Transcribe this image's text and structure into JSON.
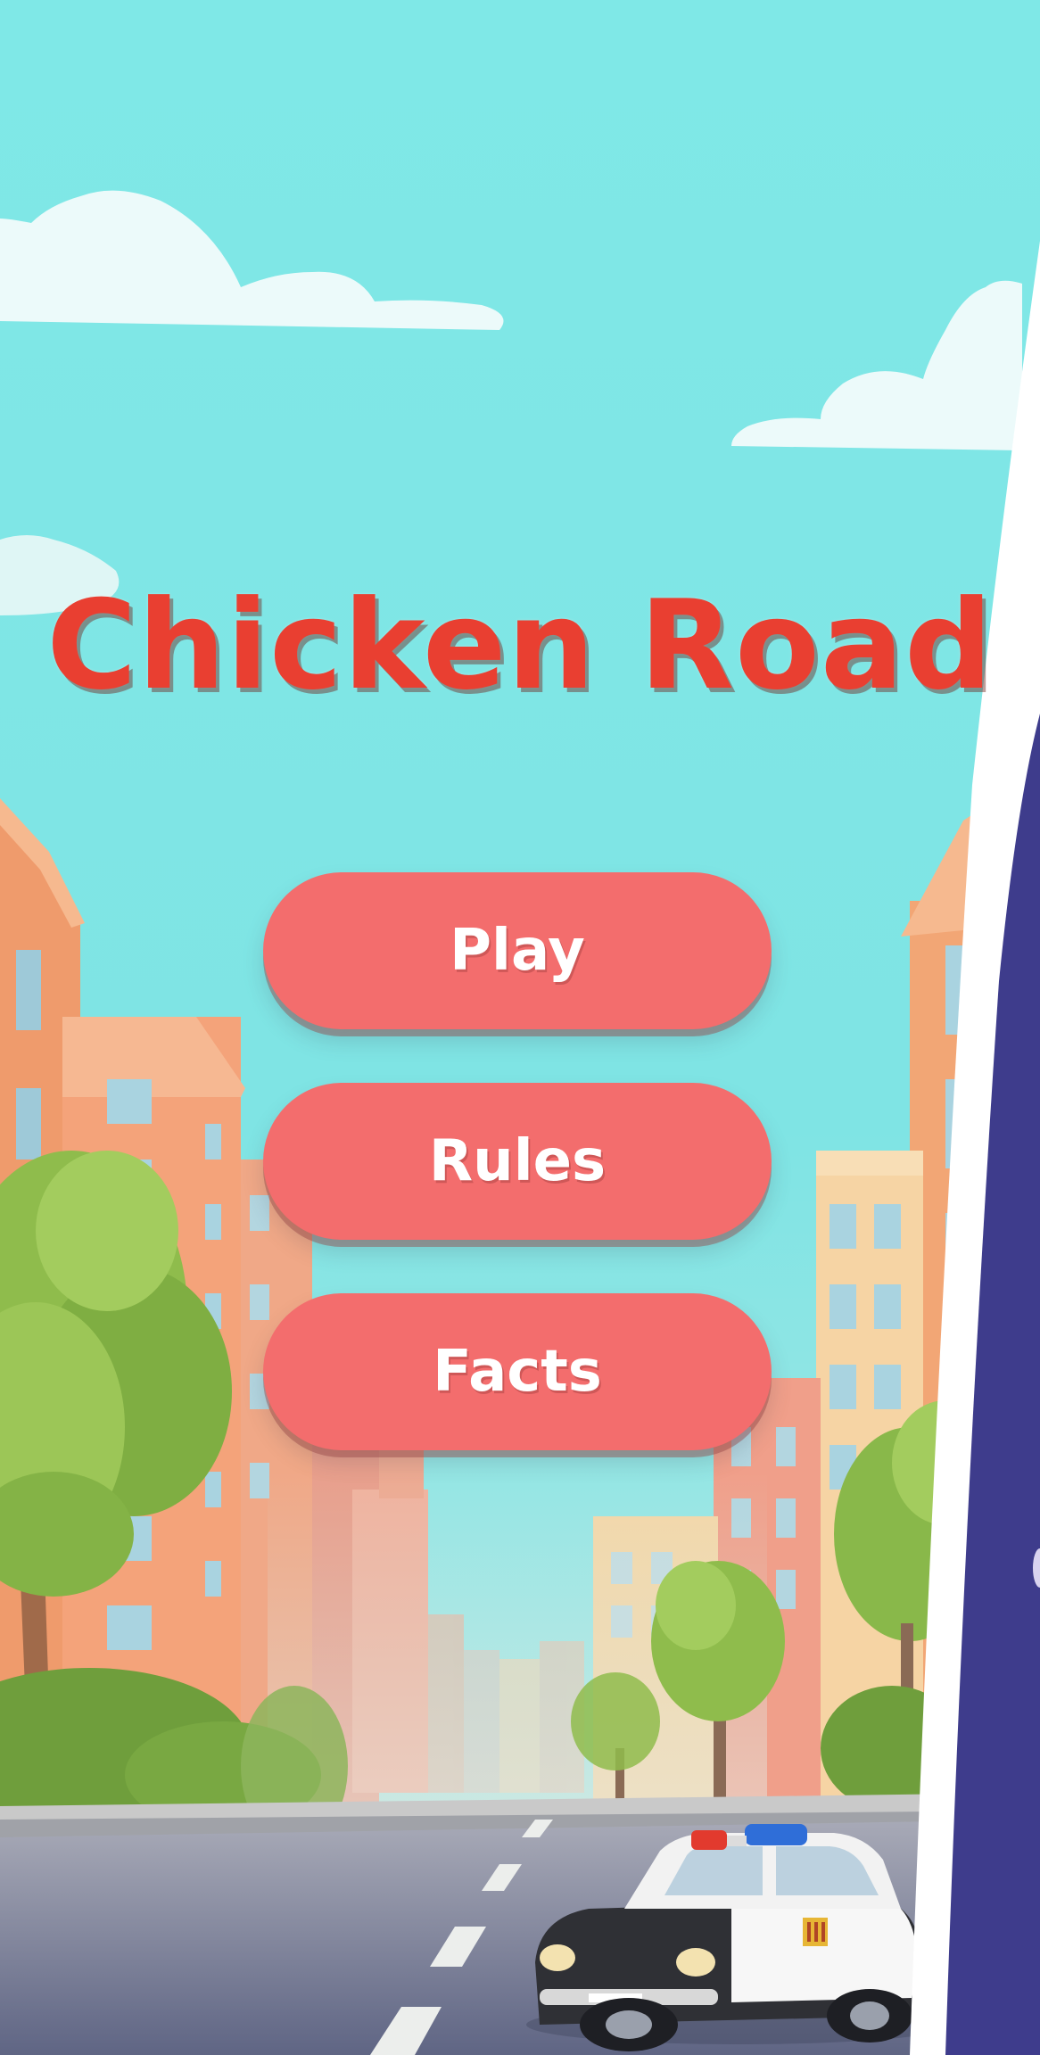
{
  "app": {
    "title": "Chicken Road"
  },
  "menu": {
    "buttons": [
      {
        "id": "play",
        "label": "Play"
      },
      {
        "id": "rules",
        "label": "Rules"
      },
      {
        "id": "facts",
        "label": "Facts"
      }
    ]
  },
  "scene": {
    "vehicle": "police-car",
    "icons": [
      "cloud-icon",
      "tree-icon",
      "building-icon",
      "police-car-icon"
    ]
  },
  "colors": {
    "sky": "#7fe6e6",
    "title": "#e93f31",
    "button": "#f36d6d",
    "road": "#6f7790",
    "side_panel": "#3f3d8e"
  }
}
